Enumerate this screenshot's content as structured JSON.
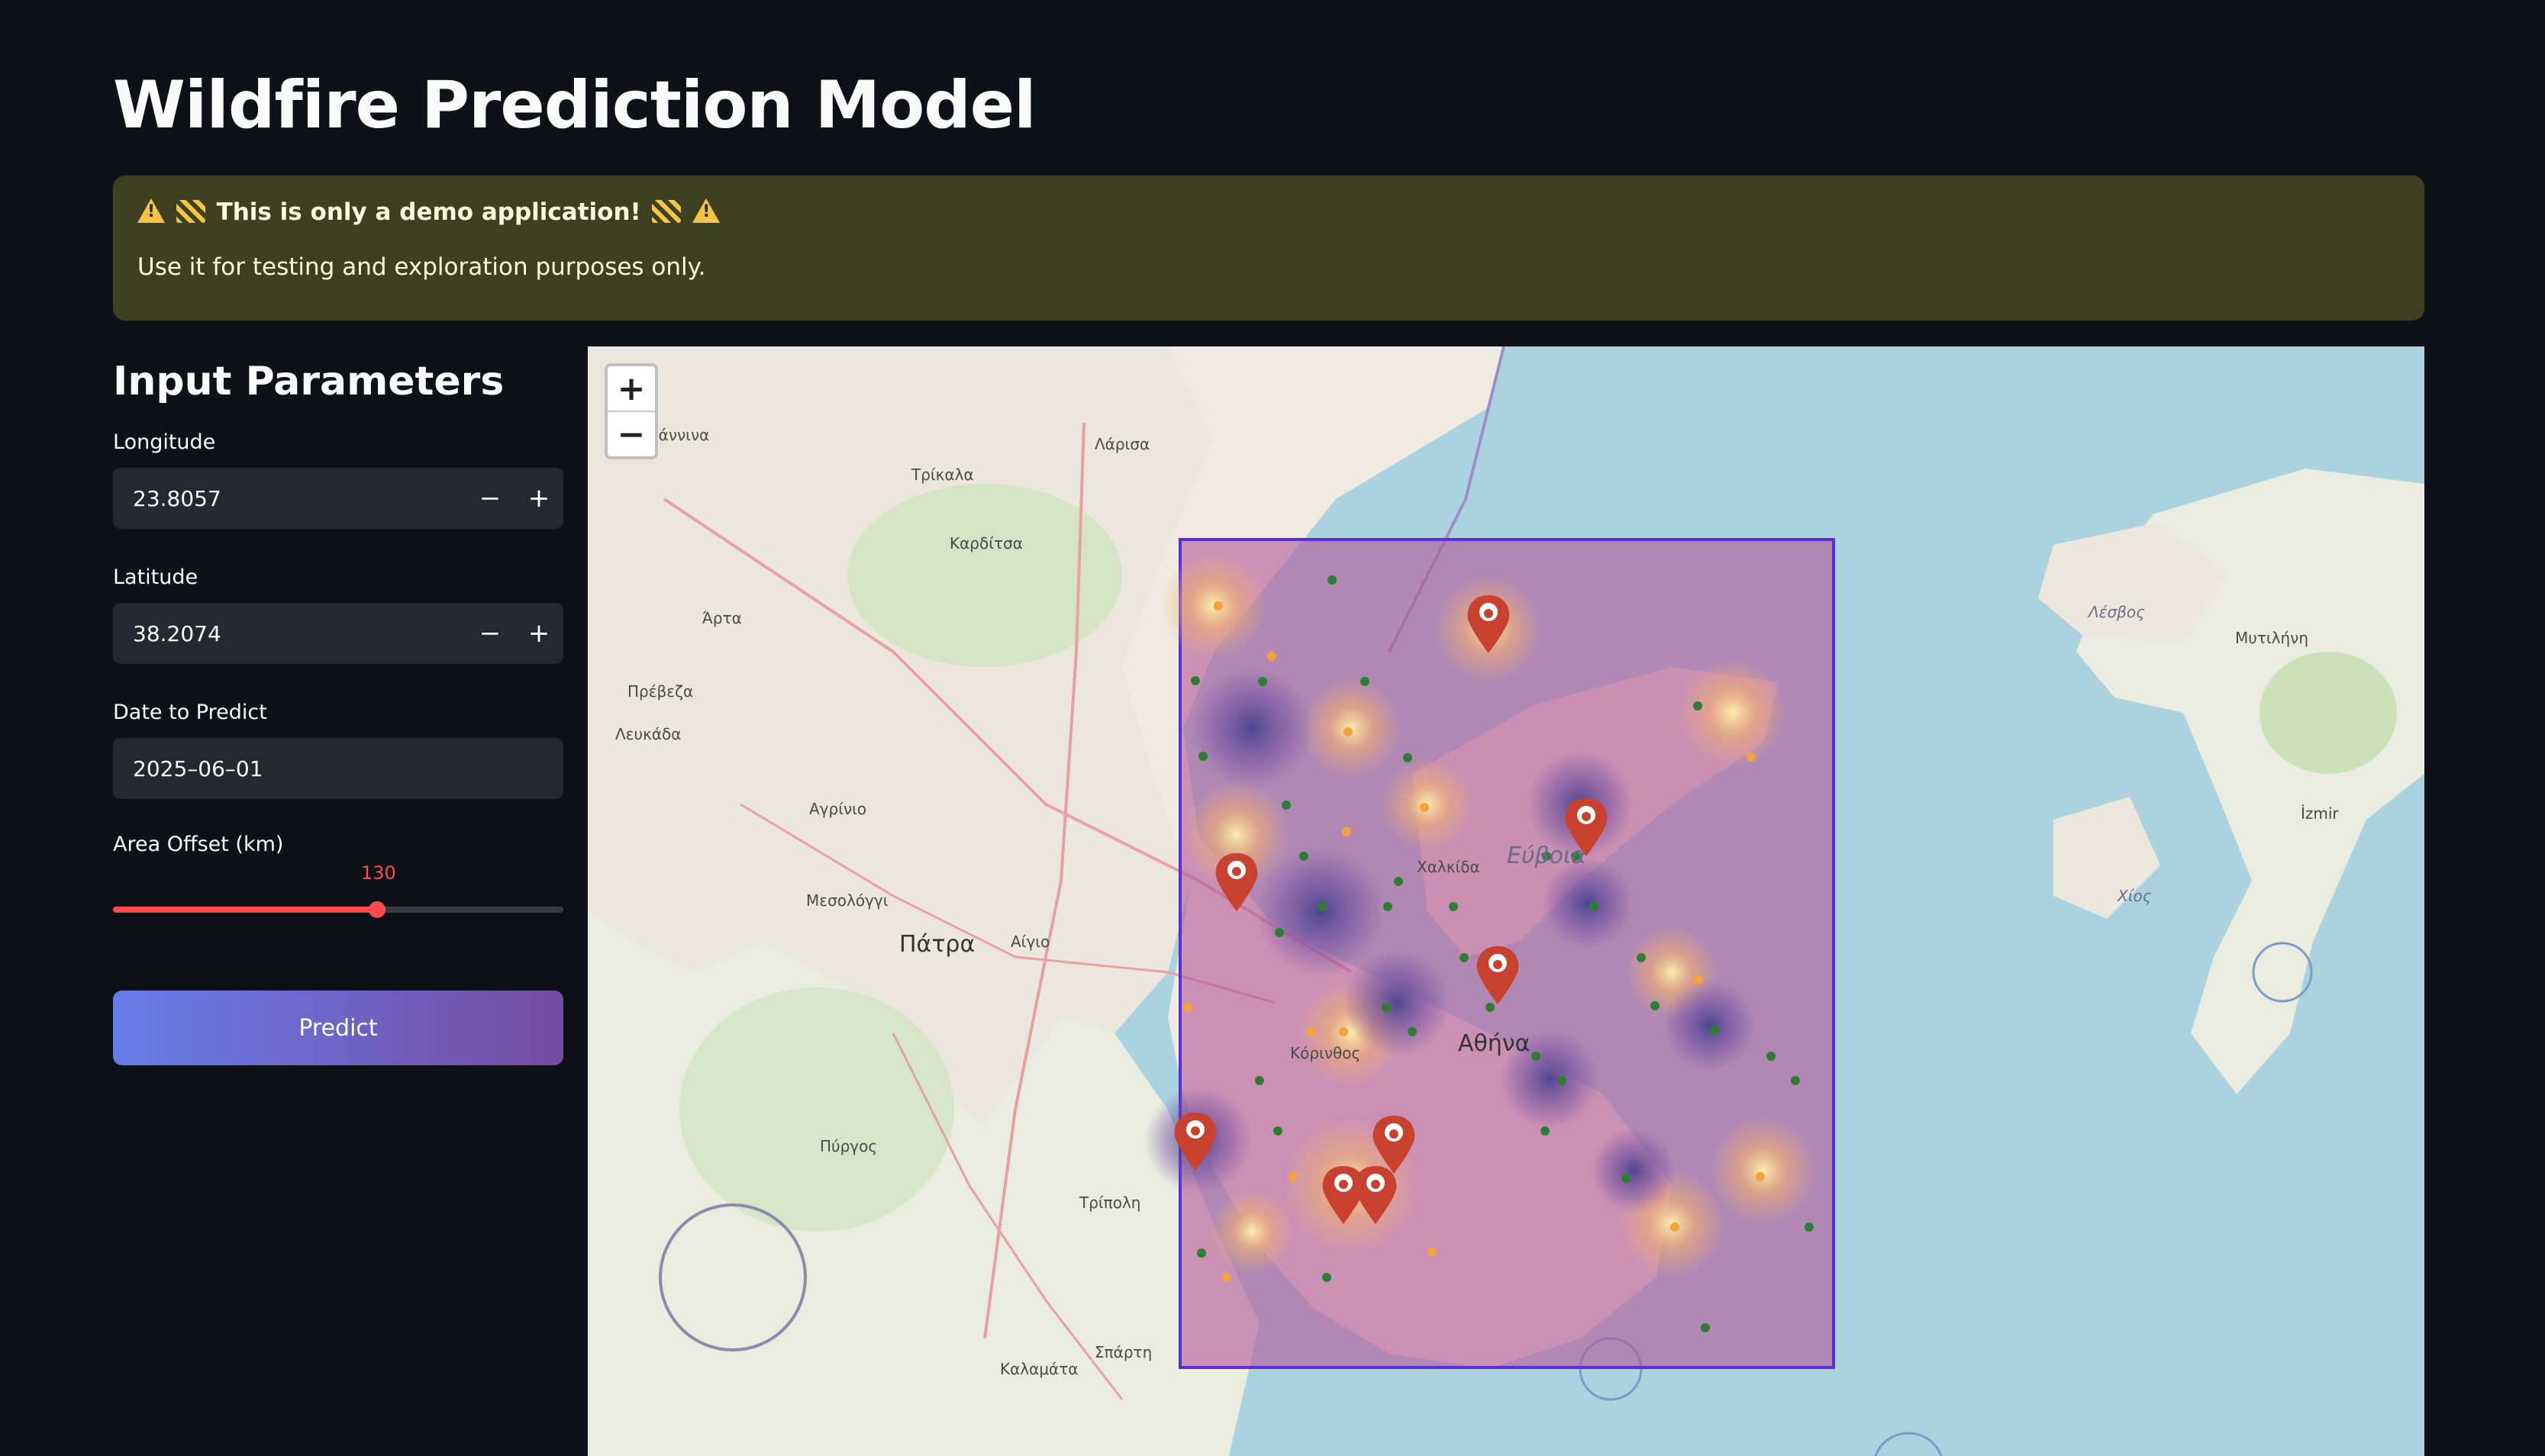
{
  "page": {
    "title": "Wildfire Prediction Model"
  },
  "alert": {
    "title": "This is only a demo application!",
    "body": "Use it for testing and exploration purposes only."
  },
  "sidebar": {
    "heading": "Input Parameters",
    "longitude": {
      "label": "Longitude",
      "value": "23.8057"
    },
    "latitude": {
      "label": "Latitude",
      "value": "38.2074"
    },
    "date": {
      "label": "Date to Predict",
      "value": "2025–06–01"
    },
    "area_offset": {
      "label": "Area Offset (km)",
      "value": "130",
      "fraction": 0.587
    },
    "predict_label": "Predict",
    "minus": "−",
    "plus": "+"
  },
  "map": {
    "zoom_in": "+",
    "zoom_out": "−",
    "labels": {
      "patra": "Πάτρα",
      "athina": "Αθήνα",
      "evia": "Εύβοια",
      "lesvos": "Λέσβος",
      "mytilini": "Μυτιλήνη",
      "chios": "Χίος",
      "larisa": "Λάρισα",
      "trikala": "Τρίκαλα",
      "karditsa": "Καρδίτσα",
      "arta": "Άρτα",
      "preveza": "Πρέβεζα",
      "lefkada": "Λευκάδα",
      "agrinio": "Αγρίνιο",
      "mesolongi": "Μεσολόγγι",
      "aigio": "Αίγιο",
      "pyrgos": "Πύργος",
      "tripoli": "Τρίπολη",
      "sparti": "Σπάρτη",
      "kalamata": "Καλαμάτα",
      "ioannina": "Ιωάννινα",
      "izmir": "İzmir",
      "chalkida": "Χαλκίδα",
      "korinthos": "Κόρινθος"
    },
    "fire_marker_icon": "fire-pin-icon",
    "colors": {
      "bbox_stroke": "#5b2fd6",
      "overlay": "#b45a9a",
      "fire_marker": "#c8412f",
      "station_point": "#2e7d32",
      "hotspot_point": "#f2a33a"
    }
  }
}
